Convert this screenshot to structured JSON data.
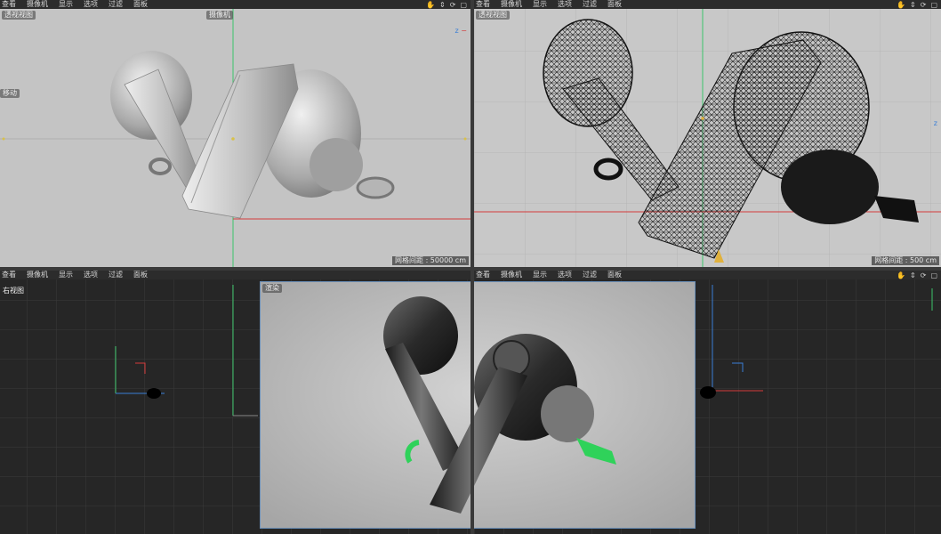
{
  "viewports": {
    "top_left": {
      "menu": [
        "查看",
        "摄像机",
        "显示",
        "选项",
        "过滤",
        "面板"
      ],
      "view_name": "透视视图",
      "camera_chip": "摄像机",
      "side_tag": "移动",
      "grid_spacing": "网格间距 : 50000 cm"
    },
    "top_right": {
      "menu": [
        "查看",
        "摄像机",
        "显示",
        "选项",
        "过滤",
        "面板"
      ],
      "view_name": "透视视图",
      "grid_spacing": "网格间距 : 500 cm"
    },
    "bottom_left": {
      "menu": [
        "查看",
        "摄像机",
        "显示",
        "选项",
        "过滤",
        "面板"
      ],
      "view_name": "右视图"
    },
    "bottom_right": {
      "menu": [
        "查看",
        "摄像机",
        "显示",
        "选项",
        "过滤",
        "面板"
      ]
    },
    "render": {
      "tag": "渲染"
    }
  },
  "colors": {
    "panel_bg": "#2c2c2c",
    "grid_dark": "#262626",
    "grid_line": "#3a3a3a",
    "axis_green": "#3cc46a",
    "axis_red": "#d43b3b",
    "axis_blue": "#3a7fd6",
    "render_border": "#6a8fb8",
    "accent_green": "#2fd25a"
  },
  "icons": [
    "hand-icon",
    "move-icon",
    "rotate-icon",
    "maximize-icon"
  ]
}
